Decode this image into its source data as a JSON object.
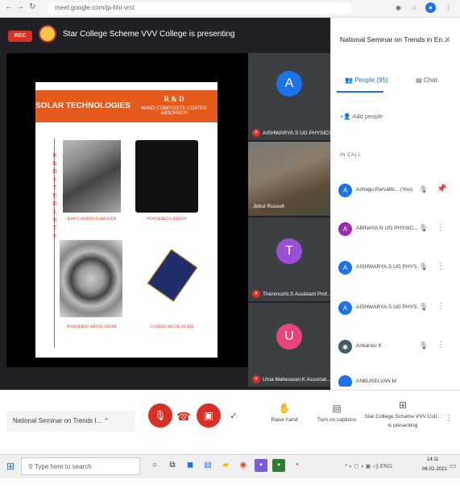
{
  "browser": {
    "url": "meet.google.com/jp-hhi-vrrz",
    "nav_back": "←",
    "nav_forward": "→",
    "nav_reload": "↻"
  },
  "meeting": {
    "rec_label": "REC",
    "presenting_title": "Star College Scheme VVV College is presenting"
  },
  "slide": {
    "solar_header": "SOLAR TECHNOLOGIES",
    "rd_title": "R & D",
    "rd_subtitle": "NANO COMPOSITE COATED ABSORBER",
    "vertical_text": "R & D   S T U D E N T S",
    "caption1": "RAW CARBON IS BROKEN",
    "caption2": "POWDERED CARBON",
    "caption3": "POWDERED METAL OXIDE",
    "caption4": "COATED METAL PLATE"
  },
  "tiles": [
    {
      "avatar": "A",
      "name": "AISHWARYA.S UG PHYSICS...",
      "color": "#1a73e8"
    },
    {
      "name": "Jebul Russell"
    },
    {
      "avatar": "T",
      "name": "Thenmozhi.S Assistant Prof...",
      "color": "#9c4fd4"
    },
    {
      "avatar": "U",
      "name": "Uma Maheswari.K Associat...",
      "color": "#e8457d"
    }
  ],
  "panel": {
    "title": "National Seminar on Trends in En...",
    "close": "×",
    "tab_people": "People (95)",
    "tab_chat": "Chat",
    "add_people": "Add people",
    "in_call": "IN CALL",
    "people": [
      {
        "initial": "A",
        "name": "Azhagu Parvathi...",
        "suffix": "(You)",
        "color": "#1a73e8"
      },
      {
        "initial": "A",
        "name": "ABINAYA.N UG PHYSIC...",
        "color": "#9c27b0"
      },
      {
        "initial": "A",
        "name": "AISHWARYA.S UG PHYS...",
        "color": "#1a73e8"
      },
      {
        "initial": "A",
        "name": "AISHWARYA.S UG PHYS...",
        "color": "#1a73e8"
      },
      {
        "initial": "",
        "name": "Anbarasi K",
        "color": "#455a64"
      },
      {
        "initial": "",
        "name": "ANBUSELVAN M",
        "color": "#1a73e8"
      }
    ]
  },
  "bottom": {
    "meeting_chip": "National Seminar on Trends I...",
    "raise_hand": "Raise hand",
    "captions": "Turn on captions",
    "presenting": "Star College Scheme VVV Coll...",
    "presenting2": "is presenting"
  },
  "taskbar": {
    "search_placeholder": "Type here to search",
    "tray": "^ ◐ ⬡ ◖ ▣ ◁) ENG",
    "time": "14:11",
    "date": "06-02-2021"
  }
}
